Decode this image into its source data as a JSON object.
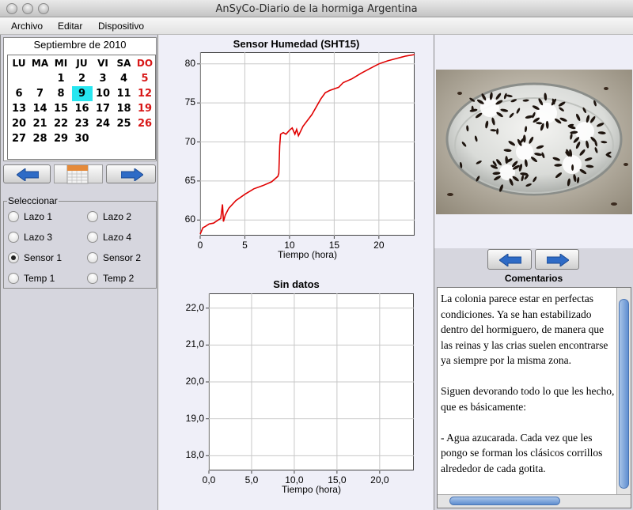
{
  "window": {
    "title": "AnSyCo-Diario de la hormiga Argentina"
  },
  "menu": {
    "items": [
      "Archivo",
      "Editar",
      "Dispositivo"
    ]
  },
  "calendar": {
    "month_title": "Septiembre de 2010",
    "weekdays": [
      "LU",
      "MA",
      "MI",
      "JU",
      "VI",
      "SA",
      "DO"
    ],
    "weeks": [
      [
        "",
        "",
        "",
        "2",
        "3",
        "4",
        "5"
      ],
      [
        "6",
        "7",
        "8",
        "9",
        "10",
        "11",
        "12"
      ],
      [
        "13",
        "14",
        "15",
        "16",
        "17",
        "18",
        "19"
      ],
      [
        "20",
        "21",
        "22",
        "23",
        "24",
        "25",
        "26"
      ],
      [
        "27",
        "28",
        "29",
        "30",
        "",
        "",
        ""
      ]
    ],
    "first_week_prefix": "1",
    "selected_day": "9",
    "colors": {
      "sunday": "#d81818",
      "selected": "#27e6f0"
    }
  },
  "selector": {
    "legend": "Seleccionar",
    "options": [
      {
        "label": "Lazo 1",
        "checked": false
      },
      {
        "label": "Lazo 2",
        "checked": false
      },
      {
        "label": "Lazo 3",
        "checked": false
      },
      {
        "label": "Lazo 4",
        "checked": false
      },
      {
        "label": "Sensor 1",
        "checked": true
      },
      {
        "label": "Sensor 2",
        "checked": false
      },
      {
        "label": "Temp 1",
        "checked": false
      },
      {
        "label": "Temp 2",
        "checked": false
      }
    ]
  },
  "chart_data": [
    {
      "type": "line",
      "title": "Sensor Humedad (SHT15)",
      "xlabel": "Tiempo (hora)",
      "ylabel": "",
      "xlim": [
        0,
        24
      ],
      "ylim": [
        58,
        81.5
      ],
      "xticks": [
        "0",
        "5",
        "10",
        "15",
        "20"
      ],
      "yticks": [
        "60",
        "65",
        "70",
        "75",
        "80"
      ],
      "grid": true,
      "color": "#e00000",
      "series": [
        {
          "x": [
            0,
            0.3,
            0.6,
            1.0,
            1.5,
            2.0,
            2.3,
            2.5,
            2.6,
            2.8,
            3.2,
            4.0,
            5.0,
            6.0,
            7.0,
            8.0,
            8.4,
            8.7,
            8.8,
            8.9,
            9.0,
            9.3,
            9.6,
            10.0,
            10.3,
            10.6,
            10.8,
            11.0,
            11.5,
            12.5,
            13.5,
            14.0,
            14.5,
            15.0,
            15.5,
            16.0,
            17.0,
            18.0,
            19.0,
            20.0,
            21.0,
            22.0,
            23.0,
            24.0
          ],
          "y": [
            58.2,
            59.0,
            59.2,
            59.5,
            59.6,
            60.0,
            60.2,
            62.0,
            59.8,
            60.6,
            61.5,
            62.5,
            63.3,
            64.0,
            64.4,
            64.9,
            65.3,
            65.6,
            66.0,
            69.5,
            71.0,
            71.2,
            71.0,
            71.5,
            71.8,
            71.0,
            71.6,
            70.8,
            72.0,
            73.5,
            75.5,
            76.3,
            76.6,
            76.8,
            77.0,
            77.6,
            78.1,
            78.8,
            79.4,
            80.0,
            80.4,
            80.7,
            81.0,
            81.2
          ]
        }
      ]
    },
    {
      "type": "line",
      "title": "Sin datos",
      "xlabel": "Tiempo (hora)",
      "ylabel": "",
      "xlim": [
        0,
        24
      ],
      "ylim": [
        17.6,
        22.4
      ],
      "xticks": [
        "0,0",
        "5,0",
        "10,0",
        "15,0",
        "20,0"
      ],
      "yticks": [
        "18,0",
        "19,0",
        "20,0",
        "21,0",
        "22,0"
      ],
      "grid": true,
      "series": []
    }
  ],
  "comments": {
    "title": "Comentarios",
    "text": "La colonia parece estar en perfectas condiciones. Ya se han estabilizado dentro del hormiguero, de manera que las reinas y las crias suelen encontrarse ya siempre por la misma zona.\n\nSiguen devorando todo lo que les hecho, que es básicamente:\n\n- Agua azucarada. Cada vez que les pongo se forman los clásicos corrillos alrededor de cada gotita.\n\nLas hormigas llegan con el abdomen delgadito y se van con éste totalmente"
  }
}
